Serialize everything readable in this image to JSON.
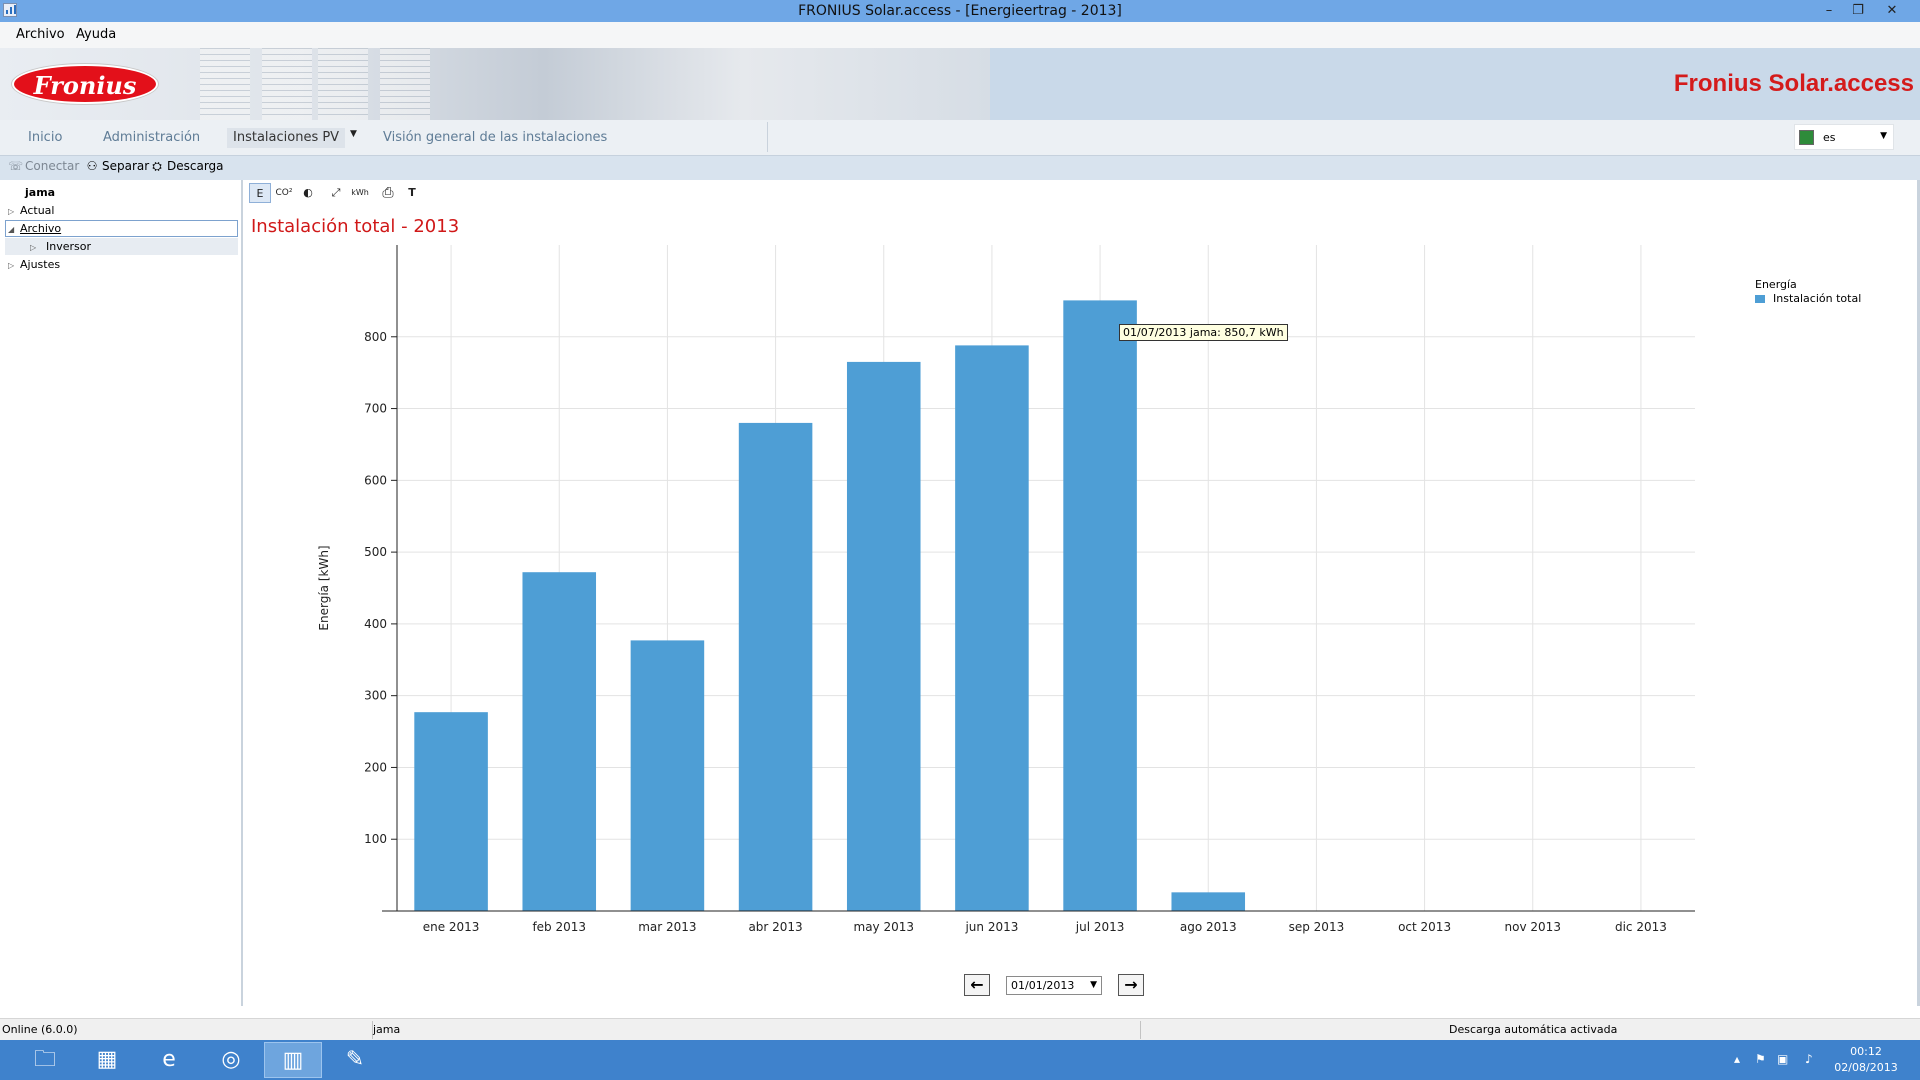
{
  "window": {
    "title": "FRONIUS Solar.access - [Energieertrag - 2013]",
    "minimize": "–",
    "restore": "❐",
    "close": "✕"
  },
  "menu": {
    "file": "Archivo",
    "help": "Ayuda"
  },
  "banner": {
    "logo_text": "Fronius",
    "product_name": "Fronius Solar.access"
  },
  "nav": {
    "tabs": [
      "Inicio",
      "Administración",
      "Instalaciones PV",
      "Visión general de las instalaciones"
    ],
    "active_tab": "Instalaciones PV",
    "language": "es"
  },
  "toolbar": {
    "connect": "Conectar",
    "disconnect": "Separar",
    "download": "Descarga"
  },
  "tree": {
    "root": "jama",
    "items": [
      "Actual",
      "Archivo",
      "Inversor",
      "Ajustes"
    ]
  },
  "chart_tools": [
    "E",
    "CO²",
    "◐",
    "⤢",
    "kWh",
    "⎙",
    "T"
  ],
  "chart": {
    "heading": "Instalación total - 2013"
  },
  "chart_data": {
    "type": "bar",
    "title": "Instalación total - 2013",
    "ylabel": "Energía [kWh]",
    "xlabel": "",
    "categories": [
      "ene 2013",
      "feb 2013",
      "mar 2013",
      "abr 2013",
      "may 2013",
      "jun 2013",
      "jul 2013",
      "ago 2013",
      "sep 2013",
      "oct 2013",
      "nov 2013",
      "dic 2013"
    ],
    "series": [
      {
        "name": "Instalación total",
        "color": "#4e9ed5",
        "values": [
          277,
          472,
          377,
          680,
          765,
          788,
          850.7,
          26,
          0,
          0,
          0,
          0
        ]
      }
    ],
    "ylim": [
      0,
      900
    ],
    "yticks": [
      100,
      200,
      300,
      400,
      500,
      600,
      700,
      800
    ],
    "grid": true,
    "legend_title": "Energía",
    "legend_position": "top-right",
    "tooltip": "01/07/2013 jama: 850,7 kWh"
  },
  "date_nav": {
    "value": "01/01/2013",
    "prev": "🡐",
    "next": "🡒"
  },
  "status": {
    "online": "Online (6.0.0)",
    "plant": "jama",
    "auto_download": "Descarga automática activada"
  },
  "taskbar": {
    "time": "00:12",
    "date": "02/08/2013"
  }
}
